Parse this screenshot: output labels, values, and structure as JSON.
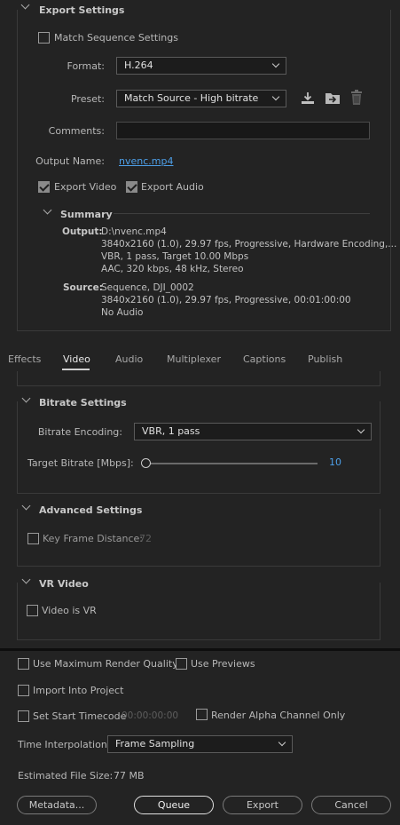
{
  "export_settings": {
    "title": "Export Settings",
    "match_sequence": {
      "label": "Match Sequence Settings",
      "checked": false
    },
    "format": {
      "label": "Format:",
      "value": "H.264"
    },
    "preset": {
      "label": "Preset:",
      "value": "Match Source - High bitrate"
    },
    "comments": {
      "label": "Comments:",
      "value": ""
    },
    "output_name": {
      "label": "Output Name:",
      "value": "nvenc.mp4"
    },
    "export_video": {
      "label": "Export Video",
      "checked": true
    },
    "export_audio": {
      "label": "Export Audio",
      "checked": true
    },
    "summary": {
      "title": "Summary",
      "output_key": "Output:",
      "output_lines": [
        "D:\\nvenc.mp4",
        "3840x2160 (1.0), 29.97 fps, Progressive, Hardware Encoding,...",
        "VBR, 1 pass, Target 10.00 Mbps",
        "AAC, 320 kbps, 48 kHz, Stereo"
      ],
      "source_key": "Source:",
      "source_lines": [
        "Sequence, DJI_0002",
        "3840x2160 (1.0), 29.97 fps, Progressive, 00:01:00:00",
        "No Audio"
      ]
    }
  },
  "tabs": [
    {
      "label": "Effects",
      "active": false
    },
    {
      "label": "Video",
      "active": true
    },
    {
      "label": "Audio",
      "active": false
    },
    {
      "label": "Multiplexer",
      "active": false
    },
    {
      "label": "Captions",
      "active": false
    },
    {
      "label": "Publish",
      "active": false
    }
  ],
  "bitrate_settings": {
    "title": "Bitrate Settings",
    "encoding": {
      "label": "Bitrate Encoding:",
      "value": "VBR, 1 pass"
    },
    "target": {
      "label": "Target Bitrate [Mbps]:",
      "value": "10",
      "fraction": 0.0
    }
  },
  "advanced_settings": {
    "title": "Advanced Settings",
    "key_frame": {
      "label": "Key Frame Distance:",
      "value": "72",
      "checked": false
    }
  },
  "vr_video": {
    "title": "VR Video",
    "is_vr": {
      "label": "Video is VR",
      "checked": false
    }
  },
  "footer": {
    "max_render": {
      "label": "Use Maximum Render Quality",
      "checked": false
    },
    "use_previews": {
      "label": "Use Previews",
      "checked": false
    },
    "import_project": {
      "label": "Import Into Project",
      "checked": false
    },
    "start_timecode": {
      "label": "Set Start Timecode",
      "value": "00:00:00:00",
      "checked": false
    },
    "render_alpha": {
      "label": "Render Alpha Channel Only",
      "checked": false
    },
    "time_interp": {
      "label": "Time Interpolation:",
      "value": "Frame Sampling"
    },
    "file_size": {
      "label": "Estimated File Size:",
      "value": "77 MB"
    },
    "buttons": {
      "metadata": "Metadata...",
      "queue": "Queue",
      "export": "Export",
      "cancel": "Cancel"
    }
  },
  "colors": {
    "accent": "#4d9fe8",
    "background": "#232323"
  },
  "icons": [
    "save-preset-icon",
    "import-preset-icon",
    "delete-preset-icon",
    "chevron-down-icon"
  ]
}
